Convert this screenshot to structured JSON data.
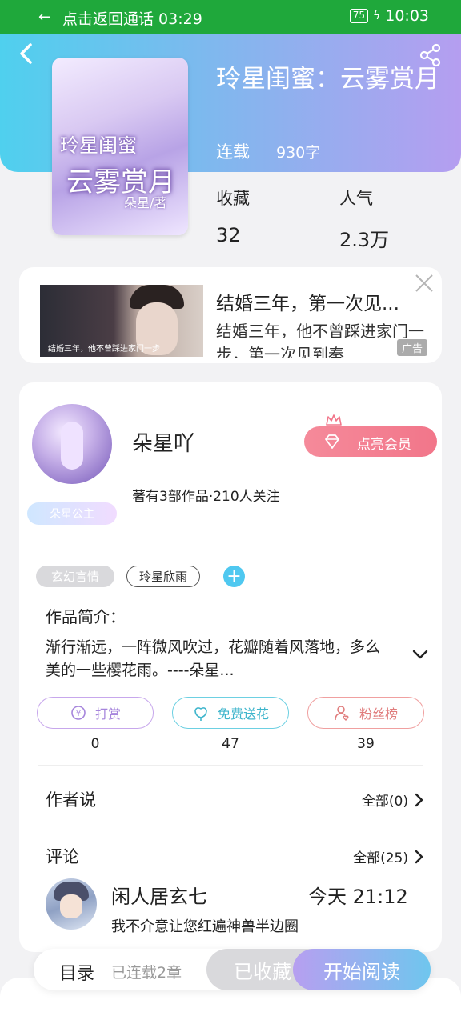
{
  "status_bar": {
    "call_text": "点击返回通话 03:29",
    "battery": "75",
    "time": "10:03"
  },
  "book": {
    "title": "玲星闺蜜：云雾赏月",
    "status": "连载",
    "word_count": "930字",
    "favorites_label": "收藏",
    "favorites_value": "32",
    "popularity_label": "人气",
    "popularity_value": "2.3万"
  },
  "ad": {
    "headline": "结婚三年，第一次见...",
    "description": "结婚三年，他不曾踩进家门一步，第一次见到秦",
    "thumb_caption": "结婚三年，他不曾踩进家门一步",
    "tag": "广告"
  },
  "author": {
    "name": "朵星吖",
    "meta": "著有3部作品·210人关注",
    "badge": "朵星公主",
    "vip_label": "点亮会员"
  },
  "tags": [
    "玄幻言情",
    "玲星欣雨"
  ],
  "intro": {
    "label": "作品简介：",
    "text": "渐行渐远，一阵微风吹过，花瓣随着风落地，多么美的一些樱花雨。----朵星..."
  },
  "actions": [
    {
      "label": "打赏",
      "count": "0",
      "icon": "coin-icon"
    },
    {
      "label": "免费送花",
      "count": "47",
      "icon": "flower-icon"
    },
    {
      "label": "粉丝榜",
      "count": "39",
      "icon": "fans-icon"
    }
  ],
  "author_says": {
    "label": "作者说",
    "all": "全部(0)"
  },
  "comments": {
    "label": "评论",
    "all": "全部(25)",
    "items": [
      {
        "user": "闲人居玄七",
        "time": "今天 21:12",
        "text": "我不介意让您红遍神兽半边圈"
      }
    ]
  },
  "bottom": {
    "toc": "目录",
    "toc_sub": "已连载2章",
    "collected": "已收藏",
    "start_reading": "开始阅读"
  },
  "colors": {
    "status_bar": "#1fa83b",
    "header_start": "#4fd0ee",
    "header_end": "#b59ef0",
    "vip": "#f2768a"
  }
}
